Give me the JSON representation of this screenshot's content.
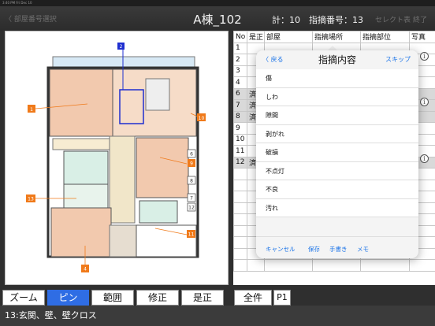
{
  "status": {
    "time": "3:40 PM  Fri Dec 10"
  },
  "header": {
    "back_label": "〈 部屋番号選択",
    "title": "A棟_102",
    "count": "計：10",
    "index": "指摘番号：13",
    "select_label": "セレクト表",
    "end_label": "終了"
  },
  "plan": {
    "markers": [
      "1",
      "2",
      "4",
      "5",
      "6",
      "7",
      "8",
      "9",
      "10",
      "11",
      "12",
      "13"
    ]
  },
  "table": {
    "headers": [
      "No",
      "是正",
      "部屋",
      "指摘場所",
      "指摘部位",
      "写真"
    ],
    "rows": [
      {
        "no": "1",
        "status": ""
      },
      {
        "no": "2",
        "status": ""
      },
      {
        "no": "3",
        "status": ""
      },
      {
        "no": "4",
        "status": ""
      },
      {
        "no": "6",
        "status": "済"
      },
      {
        "no": "7",
        "status": "済"
      },
      {
        "no": "8",
        "status": "済"
      },
      {
        "no": "9",
        "status": ""
      },
      {
        "no": "10",
        "status": ""
      },
      {
        "no": "11",
        "status": ""
      },
      {
        "no": "12",
        "status": "済"
      },
      {
        "no": "",
        "status": ""
      },
      {
        "no": "",
        "status": ""
      },
      {
        "no": "",
        "status": ""
      },
      {
        "no": "",
        "status": ""
      },
      {
        "no": "",
        "status": ""
      },
      {
        "no": "",
        "status": ""
      },
      {
        "no": "",
        "status": ""
      },
      {
        "no": "",
        "status": ""
      },
      {
        "no": "",
        "status": ""
      }
    ]
  },
  "popover": {
    "back_label": "〈 戻る",
    "title": "指摘内容",
    "skip_label": "スキップ",
    "items": [
      "傷",
      "しわ",
      "隙間",
      "剥がれ",
      "破損",
      "不点灯",
      "不良",
      "汚れ"
    ],
    "actions": [
      "キャンセル",
      "保存",
      "手書き",
      "メモ"
    ]
  },
  "toolbar": {
    "buttons": [
      "ズーム",
      "ピン",
      "範囲",
      "修正",
      "是正"
    ],
    "all_label": "全件",
    "page_label": "P1"
  },
  "footer": {
    "text": "13:玄関、壁、壁クロス"
  },
  "colors": {
    "accent": "#2f6de4",
    "marker_orange": "#f07a1a",
    "room_pink": "#f2c9ae",
    "room_blue": "#d9efe6"
  }
}
